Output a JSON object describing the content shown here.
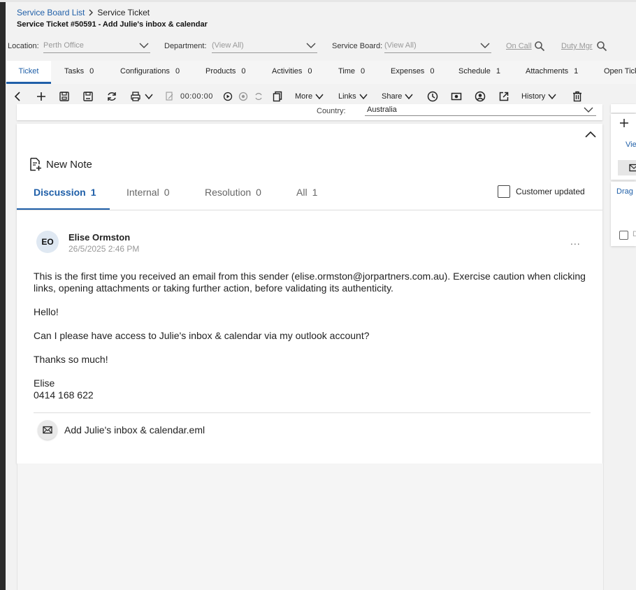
{
  "breadcrumb": {
    "parent": "Service Board List",
    "current": "Service Ticket"
  },
  "page_title": "Service Ticket #50591 - Add Julie's inbox & calendar",
  "filters": {
    "location_label": "Location:",
    "location_value": "Perth Office",
    "department_label": "Department:",
    "department_value": "(View All)",
    "service_board_label": "Service Board:",
    "service_board_value": "(View All)",
    "on_call": "On Call",
    "duty_mgr": "Duty Mgr"
  },
  "tabs": [
    {
      "label": "Ticket",
      "count": ""
    },
    {
      "label": "Tasks",
      "count": "0"
    },
    {
      "label": "Configurations",
      "count": "0"
    },
    {
      "label": "Products",
      "count": "0"
    },
    {
      "label": "Activities",
      "count": "0"
    },
    {
      "label": "Time",
      "count": "0"
    },
    {
      "label": "Expenses",
      "count": "0"
    },
    {
      "label": "Schedule",
      "count": "1"
    },
    {
      "label": "Attachments",
      "count": "1"
    },
    {
      "label": "Open Tick",
      "count": ""
    }
  ],
  "toolbar": {
    "timer": "00:00:00",
    "more": "More",
    "links": "Links",
    "share": "Share",
    "history": "History"
  },
  "country": {
    "label": "Country:",
    "value": "Australia"
  },
  "new_note": "New Note",
  "note_tabs": [
    {
      "label": "Discussion",
      "count": "1"
    },
    {
      "label": "Internal",
      "count": "0"
    },
    {
      "label": "Resolution",
      "count": "0"
    },
    {
      "label": "All",
      "count": "1"
    }
  ],
  "customer_updated": "Customer updated",
  "note": {
    "initials": "EO",
    "author": "Elise Ormston",
    "datetime": "26/5/2025 2:46 PM",
    "more": "...",
    "warning": "This is the first time you received an email from this sender (elise.ormston@jorpartners.com.au). Exercise caution when clicking links, opening attachments or taking further action, before validating its authenticity.",
    "greeting": "Hello!",
    "request": "Can I please have access to Julie's inbox & calendar via my outlook account?",
    "thanks": "Thanks so much!",
    "signature_name": "Elise",
    "signature_phone": "0414 168 622",
    "attachment": "Add Julie's inbox & calendar.eml"
  },
  "right_panel": {
    "view": "Vie",
    "drag": "Drag",
    "d": "D"
  }
}
